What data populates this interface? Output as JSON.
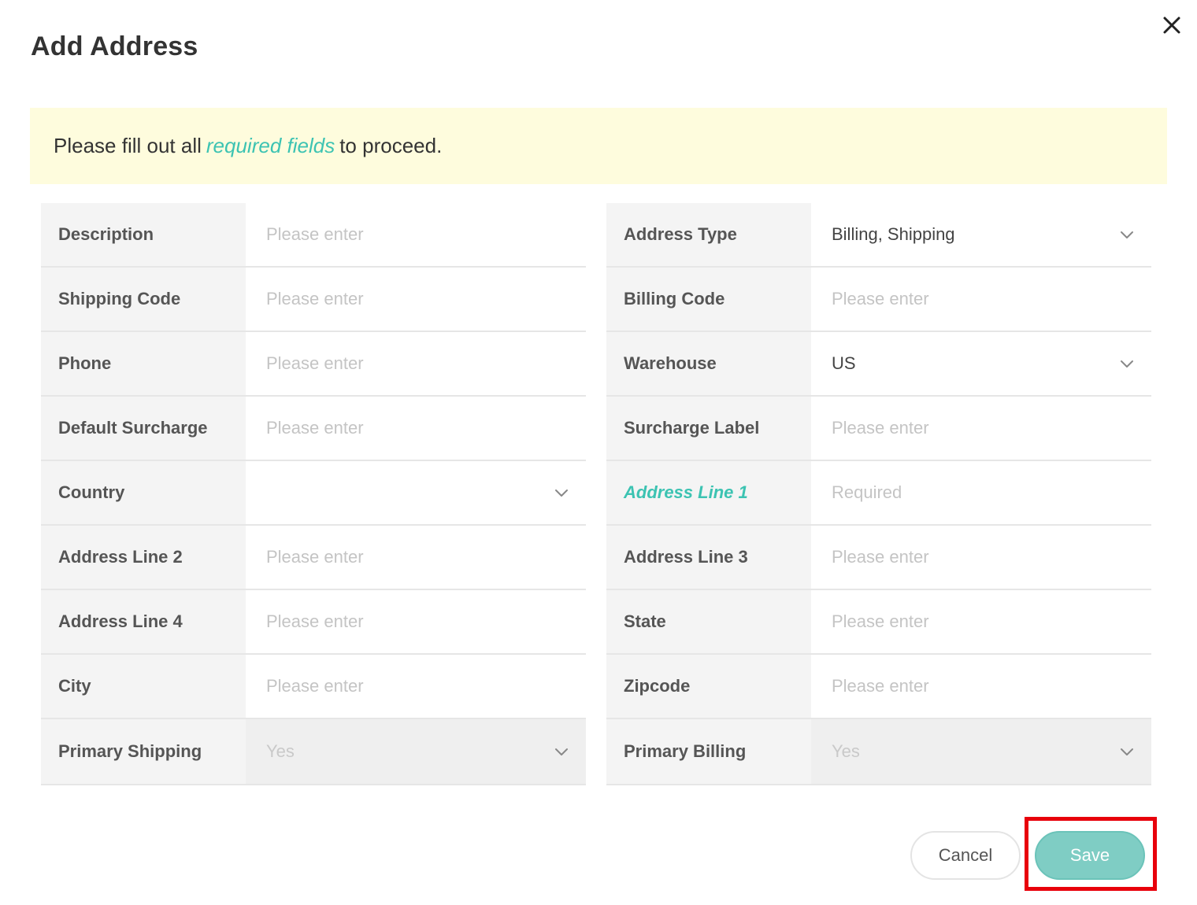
{
  "dialog": {
    "title": "Add Address",
    "close_icon": "close-icon"
  },
  "notice": {
    "prefix": "Please fill out all",
    "link": "required fields",
    "suffix": "to proceed."
  },
  "left_fields": [
    {
      "label": "Description",
      "placeholder": "Please enter",
      "type": "input"
    },
    {
      "label": "Shipping Code",
      "placeholder": "Please enter",
      "type": "input"
    },
    {
      "label": "Phone",
      "placeholder": "Please enter",
      "type": "input"
    },
    {
      "label": "Default Surcharge",
      "placeholder": "Please enter",
      "type": "input"
    },
    {
      "label": "Country",
      "value": "",
      "type": "select"
    },
    {
      "label": "Address Line 2",
      "placeholder": "Please enter",
      "type": "input"
    },
    {
      "label": "Address Line 4",
      "placeholder": "Please enter",
      "type": "input"
    },
    {
      "label": "City",
      "placeholder": "Please enter",
      "type": "input"
    },
    {
      "label": "Primary Shipping",
      "value": "Yes",
      "type": "select",
      "disabled": true
    }
  ],
  "right_fields": [
    {
      "label": "Address Type",
      "value": "Billing, Shipping",
      "type": "select"
    },
    {
      "label": "Billing Code",
      "placeholder": "Please enter",
      "type": "input"
    },
    {
      "label": "Warehouse",
      "value": "US",
      "type": "select"
    },
    {
      "label": "Surcharge Label",
      "placeholder": "Please enter",
      "type": "input"
    },
    {
      "label": "Address Line 1",
      "placeholder": "Required",
      "type": "input",
      "required": true
    },
    {
      "label": "Address Line 3",
      "placeholder": "Please enter",
      "type": "input"
    },
    {
      "label": "State",
      "placeholder": "Please enter",
      "type": "input"
    },
    {
      "label": "Zipcode",
      "placeholder": "Please enter",
      "type": "input"
    },
    {
      "label": "Primary Billing",
      "value": "Yes",
      "type": "select",
      "disabled": true
    }
  ],
  "buttons": {
    "cancel": "Cancel",
    "save": "Save"
  },
  "colors": {
    "accent": "#3cc3b2",
    "notice_bg": "#fefcdd",
    "save_bg": "#7fcdc4",
    "highlight": "#e8000b"
  }
}
